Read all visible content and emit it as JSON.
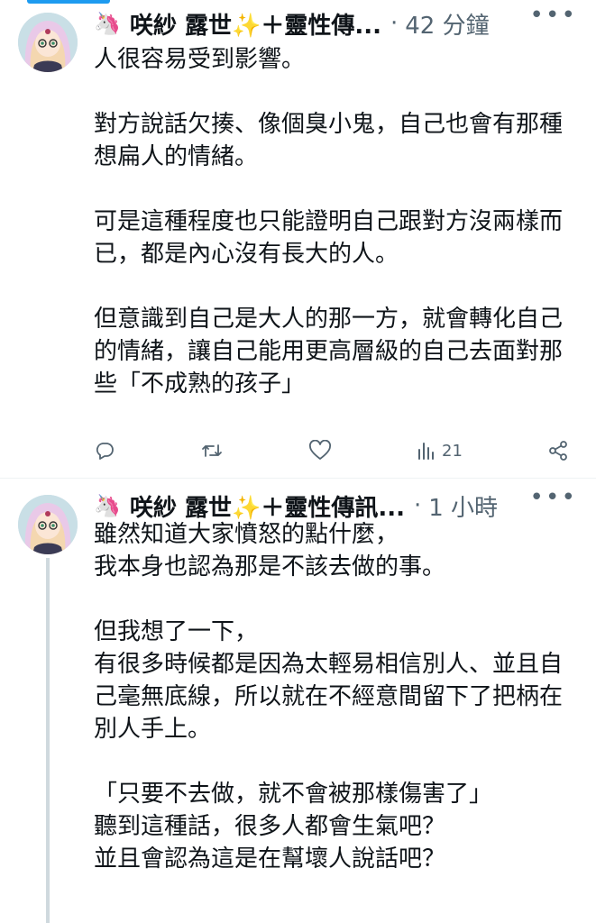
{
  "tweets": [
    {
      "author": "咲紗 露世",
      "name_suffix": "＋靈性傳...",
      "separator": "·",
      "time": "42 分鐘",
      "text": "人很容易受到影響。\n\n對方說話欠揍、像個臭小鬼，自己也會有那種想扁人的情緒。\n\n可是這種程度也只能證明自己跟對方沒兩樣而已，都是內心沒有長大的人。\n\n但意識到自己是大人的那一方，就會轉化自己的情緒，讓自己能用更高層級的自己去面對那些「不成熟的孩子」",
      "views": "21"
    },
    {
      "author": "咲紗 露世",
      "name_suffix": "＋靈性傳訊...",
      "separator": "·",
      "time": "1 小時",
      "text": "雖然知道大家憤怒的點什麼，\n我本身也認為那是不該去做的事。\n\n但我想了一下，\n有很多時候都是因為太輕易相信別人、並且自己毫無底線，所以就在不經意間留下了把柄在別人手上。\n\n「只要不去做，就不會被那樣傷害了」\n聽到這種話，很多人都會生氣吧？\n並且會認為這是在幫壞人說話吧？"
    }
  ],
  "icons": {
    "unicorn": "🦄",
    "sparkle": "✨",
    "reply": "reply-icon",
    "retweet": "retweet-icon",
    "like": "heart-icon",
    "views": "views-icon",
    "share": "share-icon",
    "more": "more-icon"
  },
  "colors": {
    "accent": "#1d9bf0",
    "text": "#0f1419",
    "muted": "#536471"
  }
}
